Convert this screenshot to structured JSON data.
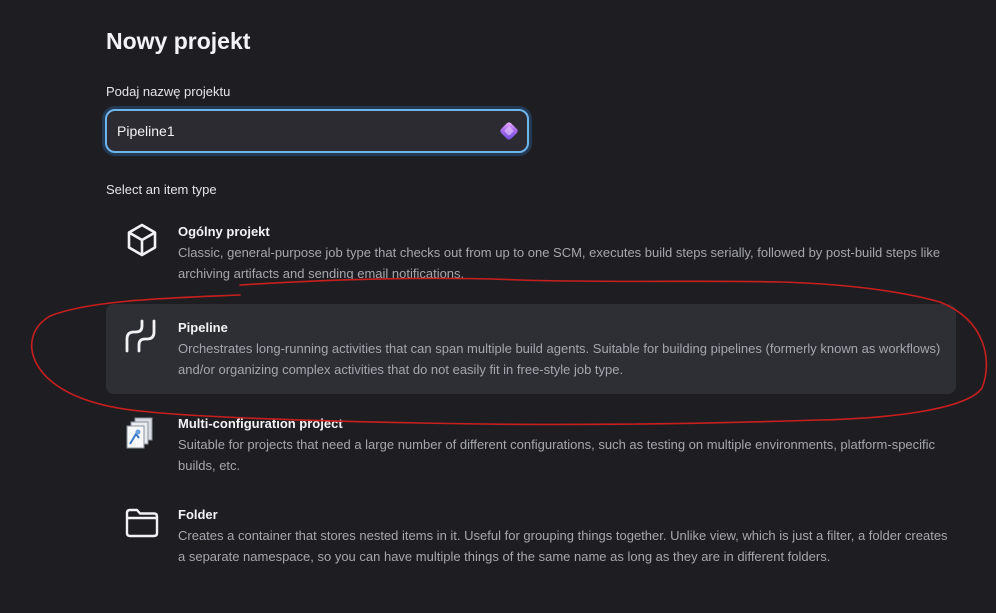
{
  "page": {
    "title": "Nowy projekt"
  },
  "name_field": {
    "label": "Podaj nazwę projektu",
    "value": "Pipeline1"
  },
  "item_types": {
    "label": "Select an item type",
    "items": [
      {
        "name": "Ogólny projekt",
        "description": "Classic, general-purpose job type that checks out from up to one SCM, executes build steps serially, followed by post-build steps like archiving artifacts and sending email notifications.",
        "icon": "package-icon",
        "selected": false
      },
      {
        "name": "Pipeline",
        "description": "Orchestrates long-running activities that can span multiple build agents. Suitable for building pipelines (formerly known as workflows) and/or organizing complex activities that do not easily fit in free-style job type.",
        "icon": "pipeline-icon",
        "selected": true
      },
      {
        "name": "Multi-configuration project",
        "description": "Suitable for projects that need a large number of different configurations, such as testing on multiple environments, platform-specific builds, etc.",
        "icon": "multi-config-icon",
        "selected": false
      },
      {
        "name": "Folder",
        "description": "Creates a container that stores nested items in it. Useful for grouping things together. Unlike view, which is just a filter, a folder creates a separate namespace, so you can have multiple things of the same name as long as they are in different folders.",
        "icon": "folder-icon",
        "selected": false
      }
    ]
  },
  "colors": {
    "background": "#1e1e22",
    "selected_background": "#2e2e35",
    "input_border": "#6fb4ea",
    "annotation_red": "#c81e1e"
  }
}
